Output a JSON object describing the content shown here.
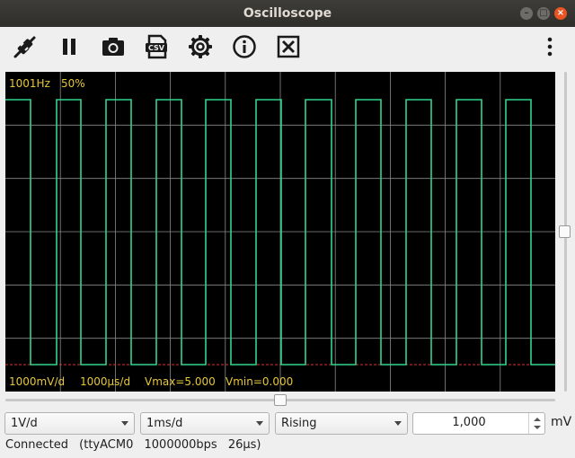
{
  "window": {
    "title": "Oscilloscope"
  },
  "toolbar": {
    "buttons": [
      {
        "icon": "plug-disconnect-icon"
      },
      {
        "icon": "pause-icon"
      },
      {
        "icon": "camera-icon"
      },
      {
        "icon": "csv-export-icon",
        "label": "CSV"
      },
      {
        "icon": "gear-icon"
      },
      {
        "icon": "info-icon"
      },
      {
        "icon": "clear-icon"
      },
      {
        "icon": "kebab-menu-icon"
      }
    ]
  },
  "scope": {
    "freq": "1001Hz",
    "duty": "50%",
    "volts_div": "1000mV/d",
    "time_div": "1000µs/d",
    "vmax": "Vmax=5.000",
    "vmin": "Vmin=0.000",
    "colors": {
      "background": "#000000",
      "trace": "#33d38e",
      "grid": "#8a8a8a",
      "text": "#e5c73a",
      "ground": "#e03030"
    }
  },
  "controls": {
    "volts_select": "1V/d",
    "time_select": "1ms/d",
    "trigger_select": "Rising",
    "trigger_level": "1,000",
    "unit": "mV"
  },
  "status": {
    "state": "Connected",
    "port": "(ttyACM0",
    "baud": "1000000bps",
    "sample": "26µs)"
  }
}
